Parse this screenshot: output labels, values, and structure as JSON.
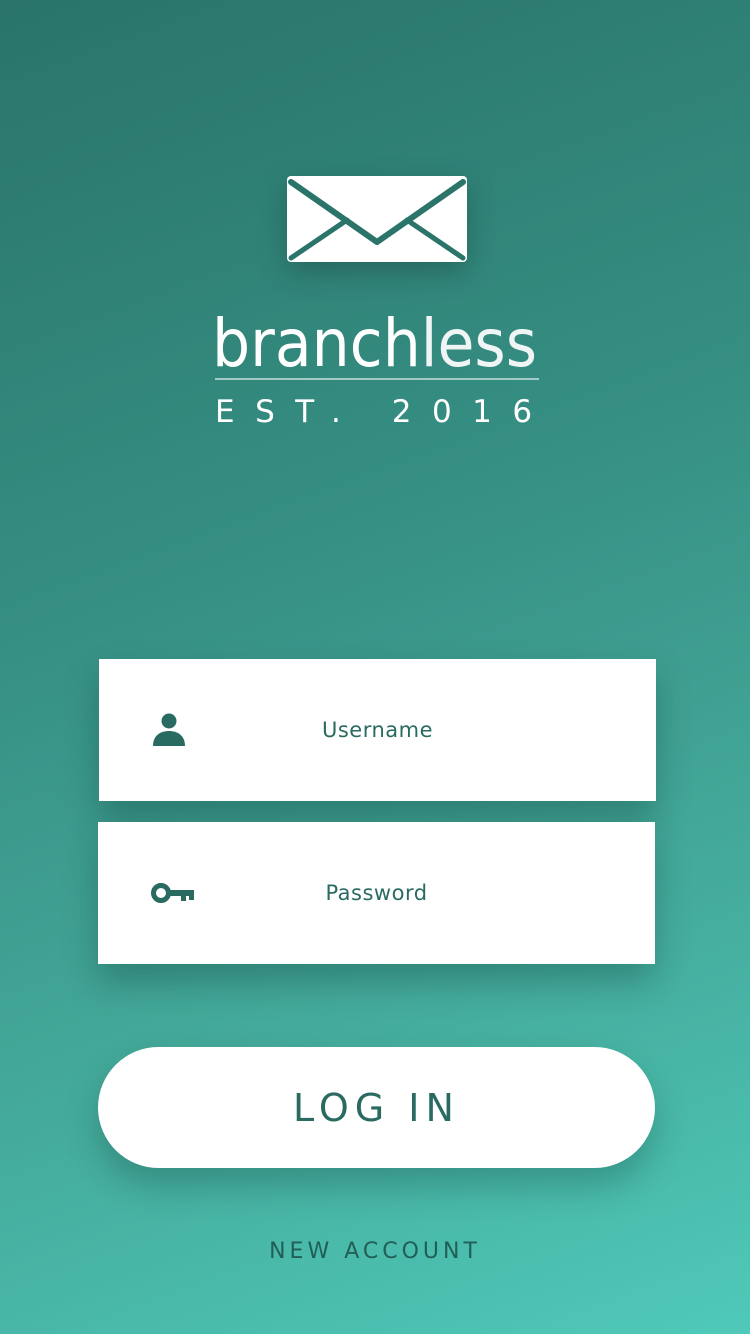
{
  "brand": {
    "name_part_1": "branch",
    "name_part_2": "less",
    "established": "EST. 2016",
    "logo_icon": "envelope-icon"
  },
  "login_form": {
    "username": {
      "placeholder": "Username",
      "value": "",
      "icon": "user-icon"
    },
    "password": {
      "placeholder": "Password",
      "value": "",
      "icon": "key-icon"
    },
    "submit_label": "LOG IN",
    "new_account_label": "NEW ACCOUNT"
  },
  "colors": {
    "background_top": "#2a7469",
    "background_bottom": "#4fc9b9",
    "accent_text": "#2a6b61",
    "card": "#ffffff"
  }
}
